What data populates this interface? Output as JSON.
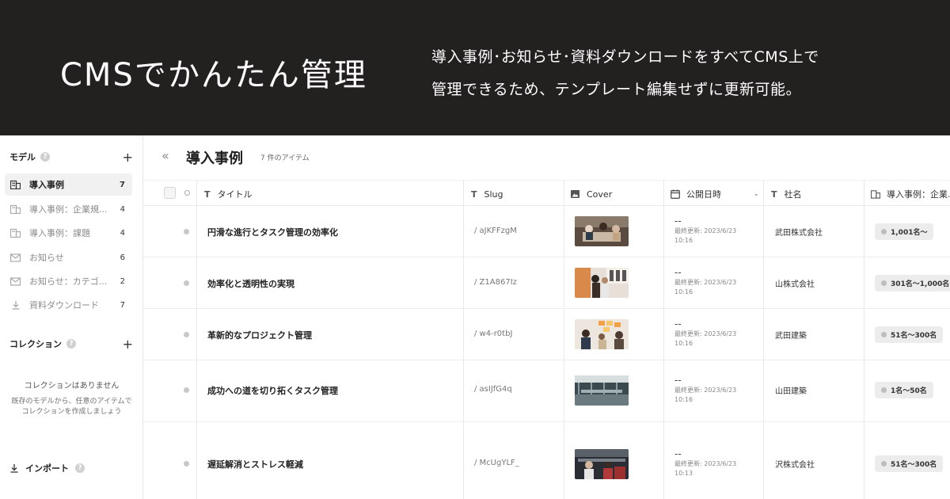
{
  "banner": {
    "title": "CMSでかんたん管理",
    "desc_line1": "導入事例･お知らせ･資料ダウンロードをすべてCMS上で",
    "desc_line2": "管理できるため、テンプレート編集せずに更新可能。"
  },
  "sidebar": {
    "models_label": "モデル",
    "help": "?",
    "plus": "+",
    "items": [
      {
        "label": "導入事例",
        "count": "7",
        "icon": "building-icon"
      },
      {
        "label": "導入事例：企業規...",
        "count": "4",
        "icon": "building-icon"
      },
      {
        "label": "導入事例：課題",
        "count": "4",
        "icon": "building-icon"
      },
      {
        "label": "お知らせ",
        "count": "6",
        "icon": "mail-icon"
      },
      {
        "label": "お知らせ：カテゴ...",
        "count": "2",
        "icon": "mail-icon"
      },
      {
        "label": "資料ダウンロード",
        "count": "7",
        "icon": "download-icon"
      }
    ],
    "collections_label": "コレクション",
    "empty_title": "コレクションはありません",
    "empty_desc1": "既存のモデルから、任意のアイテムで",
    "empty_desc2": "コレクションを作成しましょう",
    "import_label": "インポート"
  },
  "main": {
    "collapse": "«",
    "title": "導入事例",
    "item_count": "7 件のアイテム",
    "columns": {
      "title": "タイトル",
      "slug": "Slug",
      "cover": "Cover",
      "published": "公開日時",
      "company": "社名",
      "size": "導入事例：企業..."
    },
    "rows": [
      {
        "title": "円滑な進行とタスク管理の効率化",
        "slug": "/ aJKFFzgM",
        "pub_dash": "--",
        "pub_updated": "最終更新: 2023/6/23",
        "pub_time": "10:16",
        "company": "武田株式会社",
        "size": "1,001名〜"
      },
      {
        "title": "効率化と透明性の実現",
        "slug": "/ Z1A867Iz",
        "pub_dash": "--",
        "pub_updated": "最終更新: 2023/6/23",
        "pub_time": "10:16",
        "company": "山株式会社",
        "size": "301名〜1,000名"
      },
      {
        "title": "革新的なプロジェクト管理",
        "slug": "/ w4-r0tbJ",
        "pub_dash": "--",
        "pub_updated": "最終更新: 2023/6/23",
        "pub_time": "10:16",
        "company": "武田建築",
        "size": "51名〜300名"
      },
      {
        "title": "成功への道を切り拓くタスク管理",
        "slug": "/ asIJfG4q",
        "pub_dash": "--",
        "pub_updated": "最終更新: 2023/6/23",
        "pub_time": "10:16",
        "company": "山田建築",
        "size": "1名〜50名"
      },
      {
        "title": "遅延解消とストレス軽減",
        "slug": "/ McUgYLF_",
        "pub_dash": "--",
        "pub_updated": "最終更新: 2023/6/23",
        "pub_time": "10:13",
        "company": "沢株式会社",
        "size": "51名〜300名"
      }
    ]
  }
}
